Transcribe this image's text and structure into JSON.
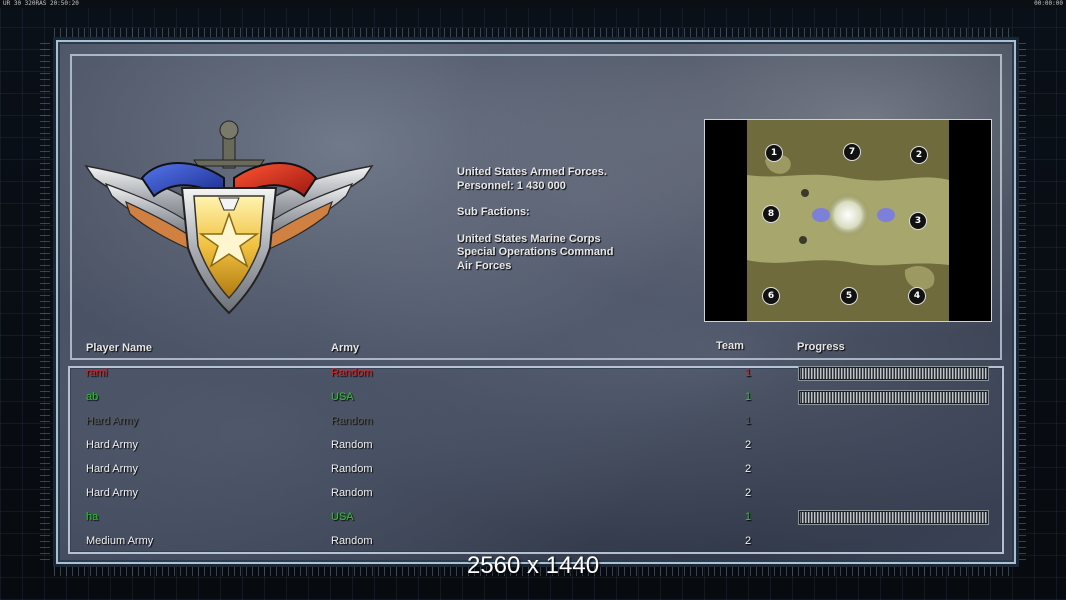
{
  "status_bar": {
    "left": "UR 30 320RAS 20:50:20",
    "right": "00:00:00"
  },
  "faction_info": {
    "name": "United States Armed Forces.",
    "personnel": "Personnel: 1 430 000",
    "sub_factions_label": "Sub Factions:",
    "sub_factions": [
      "United States Marine Corps",
      "Special Operations Command",
      "Air Forces"
    ]
  },
  "minimap": {
    "start_positions": [
      "1",
      "7",
      "2",
      "8",
      "3",
      "6",
      "5",
      "4"
    ]
  },
  "table": {
    "headers": {
      "player": "Player Name",
      "army": "Army",
      "team": "Team",
      "progress": "Progress"
    },
    "rows": [
      {
        "player": "rami",
        "army": "Random",
        "team": "1",
        "color": "#e02020",
        "progress": 1.0
      },
      {
        "player": "ab",
        "army": "USA",
        "team": "1",
        "color": "#22cc22",
        "progress": 1.0
      },
      {
        "player": "Hard Army",
        "army": "Random",
        "team": "1",
        "color": "#5a5a5a",
        "progress": null
      },
      {
        "player": "Hard Army",
        "army": "Random",
        "team": "2",
        "color": "#f0f0f0",
        "progress": null
      },
      {
        "player": "Hard Army",
        "army": "Random",
        "team": "2",
        "color": "#f0f0f0",
        "progress": null
      },
      {
        "player": "Hard Army",
        "army": "Random",
        "team": "2",
        "color": "#f0f0f0",
        "progress": null
      },
      {
        "player": "ha",
        "army": "USA",
        "team": "1",
        "color": "#22cc22",
        "progress": 1.0
      },
      {
        "player": "Medium Army",
        "army": "Random",
        "team": "2",
        "color": "#f0f0f0",
        "progress": null
      }
    ]
  },
  "watermark": "2560 x 1440"
}
